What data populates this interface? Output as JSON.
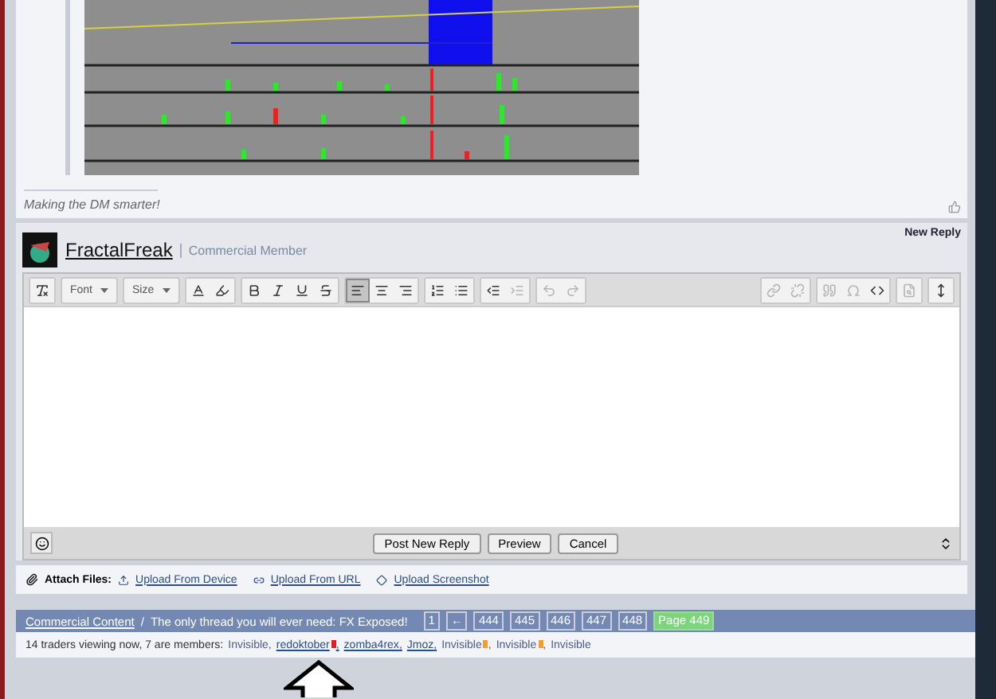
{
  "post": {
    "signature": "Making the DM smarter!"
  },
  "reply": {
    "username": "FractalFreak",
    "user_title": "Commercial Member",
    "heading": "New Reply",
    "toolbar": {
      "font": "Font",
      "size": "Size",
      "buttons": [
        {
          "selected": false,
          "disabled": false
        },
        {
          "selected": false,
          "disabled": false
        },
        {
          "selected": false,
          "disabled": false
        },
        {
          "selected": false,
          "disabled": false
        },
        {
          "selected": false,
          "disabled": false
        },
        {
          "selected": true,
          "disabled": false
        },
        {
          "selected": false,
          "disabled": false
        },
        {
          "selected": false,
          "disabled": false
        },
        {
          "selected": false,
          "disabled": false
        },
        {
          "selected": false,
          "disabled": false
        },
        {
          "selected": false,
          "disabled": false
        },
        {
          "selected": false,
          "disabled": true
        },
        {
          "selected": false,
          "disabled": true
        },
        {
          "selected": false,
          "disabled": true
        },
        {
          "selected": false,
          "disabled": true
        },
        {
          "selected": false,
          "disabled": true
        },
        {
          "selected": false,
          "disabled": true
        },
        {
          "selected": false,
          "disabled": true
        },
        {
          "selected": false,
          "disabled": false
        },
        {
          "selected": false,
          "disabled": true
        },
        {
          "selected": false,
          "disabled": false
        }
      ]
    },
    "buttons": [
      "Post New Reply",
      "Preview",
      "Cancel"
    ],
    "attach_label": "Attach Files:",
    "attach_links": [
      "Upload From Device",
      "Upload From URL",
      "Upload Screenshot"
    ]
  },
  "breadcrumb": {
    "forum": "Commercial Content",
    "separator": "/",
    "thread": "The only thread you will ever need: FX Exposed!",
    "pages": [
      {
        "label": "1",
        "selected": false
      },
      {
        "label": "←",
        "selected": false
      },
      {
        "label": "444",
        "selected": false
      },
      {
        "label": "445",
        "selected": false
      },
      {
        "label": "446",
        "selected": false
      },
      {
        "label": "447",
        "selected": false
      },
      {
        "label": "448",
        "selected": false
      },
      {
        "label": "Page 449",
        "selected": true
      }
    ]
  },
  "viewers": {
    "summary": "14 traders viewing now, 7 are members:",
    "separator": ",",
    "members": [
      {
        "name": "Invisible",
        "link": false
      },
      {
        "name": "redoktober",
        "link": true,
        "color": "#e02020"
      },
      {
        "name": "zomba4rex",
        "link": true
      },
      {
        "name": "Jmoz",
        "link": true
      },
      {
        "name": "Invisible",
        "link": false,
        "color": "#f0a030"
      },
      {
        "name": "Invisible",
        "link": false,
        "color": "#f0a030"
      },
      {
        "name": "Invisible",
        "link": false
      }
    ]
  }
}
